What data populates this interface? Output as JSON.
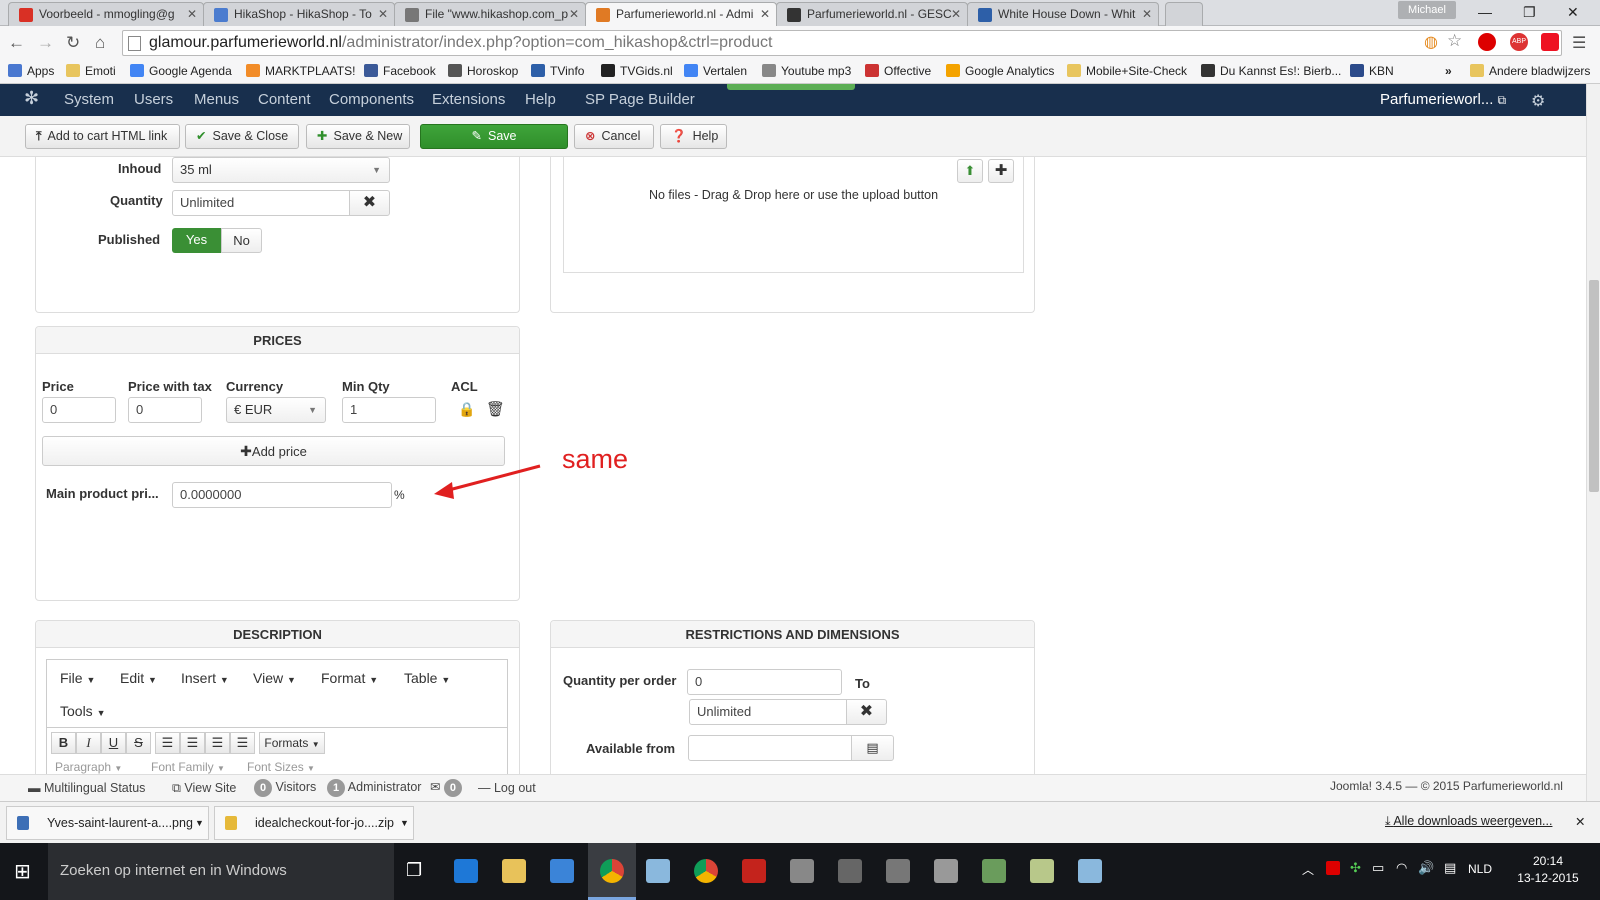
{
  "browser": {
    "tabs": [
      {
        "title": "Voorbeeld - mmogling@g",
        "color": "#d93025"
      },
      {
        "title": "HikaShop - HikaShop - To",
        "color": "#4b7ccf"
      },
      {
        "title": "File \"www.hikashop.com_p",
        "color": "#555555"
      },
      {
        "title": "Parfumerieworld.nl - Admi",
        "color": "#e07a24"
      },
      {
        "title": "Parfumerieworld.nl - GESC",
        "color": "#333333"
      },
      {
        "title": "White House Down - Whit",
        "color": "#2d5fa8"
      }
    ],
    "profile": "Michael",
    "url_host": "glamour.parfumerieworld.nl",
    "url_path": "/administrator/index.php?option=com_hikashop&ctrl=product",
    "bookmarks": [
      "Apps",
      "Emoti",
      "Google Agenda",
      "MARKTPLAATS!",
      "Facebook",
      "Horoskop",
      "TVinfo",
      "TVGids.nl",
      "Vertalen",
      "Youtube mp3",
      "Offective",
      "Google Analytics",
      "Mobile+Site-Check",
      "Du Kannst Es!: Bierb...",
      "KBN",
      "»",
      "Andere bladwijzers"
    ]
  },
  "jnav": {
    "items": [
      "System",
      "Users",
      "Menus",
      "Content",
      "Components",
      "Extensions",
      "Help",
      "SP Page Builder"
    ],
    "site_name": "Parfumerieworl..."
  },
  "toolbar": {
    "add_to_cart": "Add to cart HTML link",
    "save_close": "Save & Close",
    "save_new": "Save & New",
    "save": "Save",
    "cancel": "Cancel",
    "help": "Help"
  },
  "product": {
    "inhoud_label": "Inhoud",
    "inhoud_value": "35 ml",
    "quantity_label": "Quantity",
    "quantity_value": "Unlimited",
    "published_label": "Published",
    "published_yes": "Yes",
    "published_no": "No"
  },
  "files": {
    "message": "No files - Drag & Drop here or use the upload button"
  },
  "prices": {
    "title": "PRICES",
    "headers": [
      "Price",
      "Price with tax",
      "Currency",
      "Min Qty",
      "ACL"
    ],
    "row": {
      "price": "0",
      "price_with_tax": "0",
      "currency": "€ EUR",
      "min_qty": "1"
    },
    "add_price": "Add price",
    "main_product_label": "Main product pri...",
    "main_product_value": "0.0000000",
    "percent": "%"
  },
  "annotation": {
    "text": "same",
    "color": "#e02020"
  },
  "description": {
    "title": "DESCRIPTION",
    "menus": [
      "File",
      "Edit",
      "Insert",
      "View",
      "Format",
      "Table",
      "Tools"
    ],
    "format_buttons": [
      "B",
      "I",
      "U",
      "S"
    ],
    "formats_label": "Formats",
    "paragraph": "Paragraph",
    "font_family": "Font Family",
    "font_sizes": "Font Sizes"
  },
  "restrictions": {
    "title": "RESTRICTIONS AND DIMENSIONS",
    "qty_per_order_label": "Quantity per order",
    "qty_min": "0",
    "to_label": "To",
    "qty_max": "Unlimited",
    "available_from_label": "Available from",
    "available_from_value": ""
  },
  "statusbar": {
    "multilingual": "Multilingual Status",
    "view_site": "View Site",
    "visitors_count": "0",
    "visitors": "Visitors",
    "admin_count": "1",
    "administrator": "Administrator",
    "msg_count": "0",
    "logout": "Log out",
    "version": "Joomla! 3.4.5 — © 2015 Parfumerieworld.nl"
  },
  "downloads": {
    "items": [
      "Yves-saint-laurent-a....png",
      "idealcheckout-for-jo....zip"
    ],
    "show_all": "Alle downloads weergeven..."
  },
  "taskbar": {
    "search_placeholder": "Zoeken op internet en in Windows",
    "language": "NLD",
    "time": "20:14",
    "date": "13-12-2015"
  },
  "colors": {
    "joomla_nav": "#182f4d",
    "save_green": "#2f8f2b",
    "published_green": "#3a8f35"
  }
}
